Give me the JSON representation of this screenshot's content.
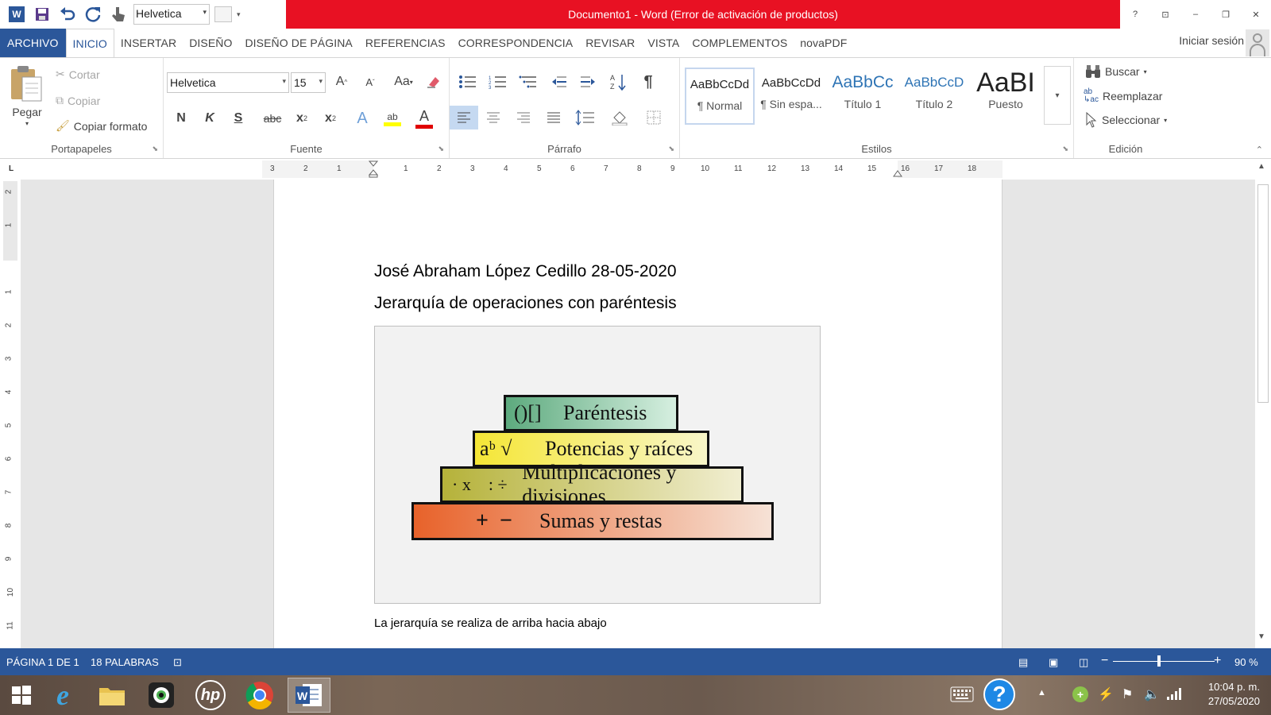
{
  "window": {
    "title": "Documento1 - Word (Error de activación de productos)",
    "qat_font": "Helvetica",
    "controls": [
      "?",
      "⊡",
      "–",
      "❐",
      "✕"
    ]
  },
  "tabs": [
    {
      "label": "ARCHIVO"
    },
    {
      "label": "INICIO"
    },
    {
      "label": "INSERTAR"
    },
    {
      "label": "DISEÑO"
    },
    {
      "label": "DISEÑO DE PÁGINA"
    },
    {
      "label": "REFERENCIAS"
    },
    {
      "label": "CORRESPONDENCIA"
    },
    {
      "label": "REVISAR"
    },
    {
      "label": "VISTA"
    },
    {
      "label": "COMPLEMENTOS"
    },
    {
      "label": "novaPDF"
    }
  ],
  "signin": "Iniciar sesión",
  "ribbon": {
    "clipboard": {
      "label": "Portapapeles",
      "paste": "Pegar",
      "cut": "Cortar",
      "copy": "Copiar",
      "format_painter": "Copiar formato"
    },
    "font": {
      "label": "Fuente",
      "family": "Helvetica",
      "size": "15",
      "bold": "N",
      "italic": "K",
      "underline": "S",
      "strike": "abc",
      "grow": "A",
      "shrink": "A",
      "case": "Aa",
      "effects": "A",
      "highlight": "ab",
      "color": "A"
    },
    "paragraph": {
      "label": "Párrafo"
    },
    "styles": {
      "label": "Estilos",
      "items": [
        {
          "sample": "AaBbCcDd",
          "name": "¶ Normal"
        },
        {
          "sample": "AaBbCcDd",
          "name": "¶ Sin espa..."
        },
        {
          "sample": "AaBbCc",
          "name": "Título 1"
        },
        {
          "sample": "AaBbCcD",
          "name": "Título 2"
        },
        {
          "sample": "AaBI",
          "name": "Puesto"
        }
      ]
    },
    "editing": {
      "label": "Edición",
      "find": "Buscar",
      "replace": "Reemplazar",
      "select": "Seleccionar"
    }
  },
  "ruler": {
    "corner": "L",
    "h_marks": [
      "3",
      "2",
      "1",
      "1",
      "2",
      "3",
      "4",
      "5",
      "6",
      "7",
      "8",
      "9",
      "10",
      "11",
      "12",
      "13",
      "14",
      "15",
      "16",
      "17",
      "18"
    ],
    "v_marks": [
      "2",
      "1",
      "1",
      "2",
      "3",
      "4",
      "5",
      "6",
      "7",
      "8",
      "9",
      "10",
      "11"
    ]
  },
  "document": {
    "line1": "José Abraham López Cedillo 28-05-2020",
    "line2": "Jerarquía de operaciones con paréntesis",
    "caption": "La jerarquía se realiza de arriba hacia abajo",
    "pyramid": [
      {
        "symbol": "()[]",
        "label": "Paréntesis",
        "color_from": "#5daa7e",
        "color_to": "#d6efe0"
      },
      {
        "symbol": "aᵇ √",
        "label": "Potencias y raíces",
        "color_from": "#f5e636",
        "color_to": "#f8f6c8"
      },
      {
        "symbol": "· x    : ÷",
        "label": "Multiplicaciones y divisiones",
        "color_from": "#b5b23a",
        "color_to": "#f1eed1"
      },
      {
        "symbol": "+  −",
        "label": "Sumas y restas",
        "color_from": "#e8622a",
        "color_to": "#f6e2d6"
      }
    ]
  },
  "status": {
    "page": "PÁGINA 1 DE 1",
    "words": "18 PALABRAS",
    "zoom": "90 %",
    "zoom_minus": "−",
    "zoom_plus": "+"
  },
  "taskbar": {
    "time": "10:04 p. m.",
    "date": "27/05/2020"
  },
  "colors": {
    "word_blue": "#2b579a",
    "title_red": "#e81123"
  }
}
